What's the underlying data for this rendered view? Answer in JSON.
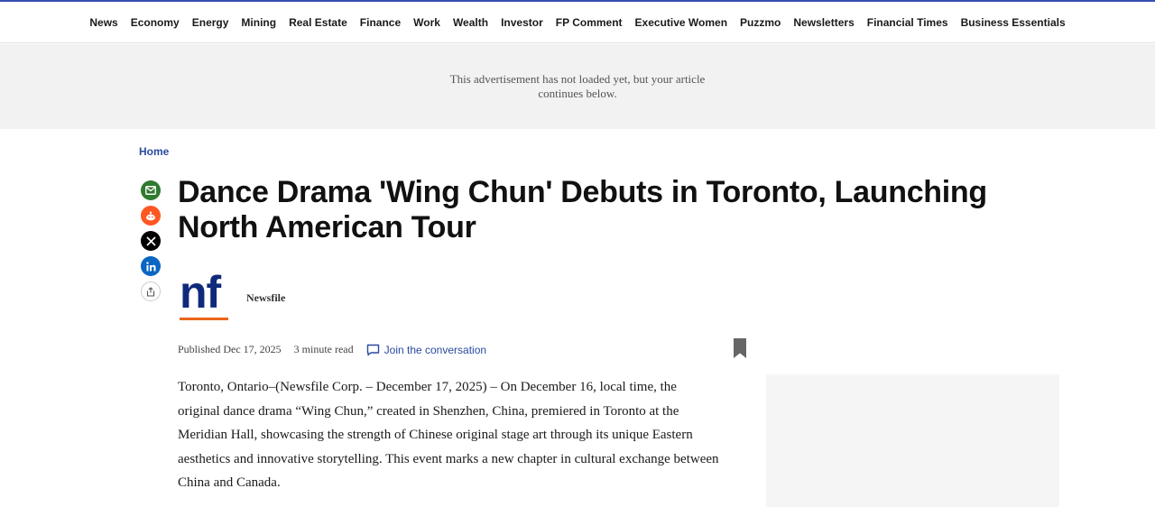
{
  "nav": {
    "items": [
      "News",
      "Economy",
      "Energy",
      "Mining",
      "Real Estate",
      "Finance",
      "Work",
      "Wealth",
      "Investor",
      "FP Comment",
      "Executive Women",
      "Puzzmo",
      "Newsletters",
      "Financial Times",
      "Business Essentials"
    ]
  },
  "ad": {
    "message": "This advertisement has not loaded yet, but your article continues below."
  },
  "breadcrumb": {
    "home": "Home"
  },
  "share": {
    "icons": [
      "email-icon",
      "reddit-icon",
      "x-icon",
      "linkedin-icon",
      "share-icon"
    ]
  },
  "article": {
    "headline": "Dance Drama 'Wing Chun' Debuts in Toronto, Launching North American Tour",
    "source_logo_text": "nf",
    "source_name": "Newsfile",
    "published": "Published Dec 17, 2025",
    "read_time": "3 minute read",
    "join_label": "Join the conversation",
    "body": "Toronto, Ontario–(Newsfile Corp. – December 17, 2025) – On December 16, local time, the original dance drama “Wing Chun,” created in Shenzhen, China, premiered in Toronto at the Meridian Hall, showcasing the strength of Chinese original stage art through its unique Eastern aesthetics and innovative storytelling. This event marks a new chapter in cultural exchange between China and Canada."
  },
  "colors": {
    "accent_blue": "#2a4aa0",
    "logo_navy": "#0f2a7a",
    "logo_orange": "#e8651a",
    "email_green": "#2f7a2f",
    "reddit_orange": "#ff5722",
    "linkedin_blue": "#0a66c2"
  }
}
